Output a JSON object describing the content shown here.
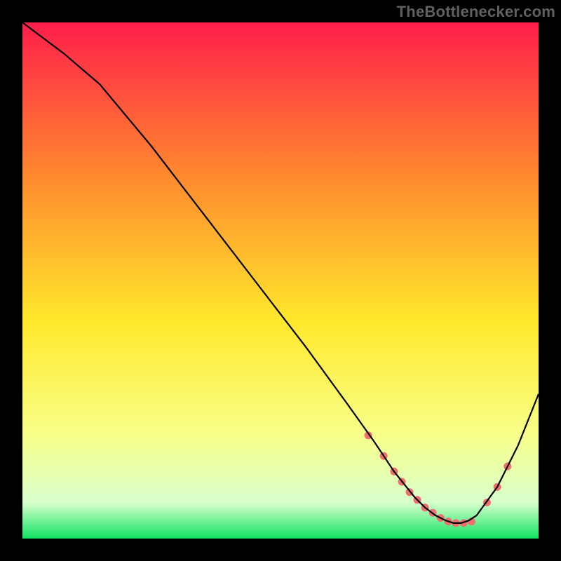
{
  "credit": "TheBottlenecker.com",
  "chart_data": {
    "type": "line",
    "title": "",
    "xlabel": "",
    "ylabel": "",
    "xlim": [
      0,
      100
    ],
    "ylim": [
      0,
      100
    ],
    "legend": false,
    "grid": false,
    "background_gradient": {
      "top": "#ff1e4b",
      "upper_mid": "#ff8a2e",
      "mid": "#ffe92c",
      "lower_mid": "#f8ff8a",
      "near_bottom": "#d8ffcc",
      "bottom": "#11e263"
    },
    "series": [
      {
        "name": "bottleneck-curve",
        "color": "#000000",
        "x": [
          0,
          8,
          15,
          25,
          35,
          45,
          55,
          63,
          68,
          70,
          72,
          74,
          76,
          78,
          80,
          82,
          83.5,
          85,
          86.5,
          88,
          92,
          96,
          100
        ],
        "y": [
          100,
          94,
          88,
          76,
          63,
          50,
          37,
          26,
          19,
          16,
          13,
          10.5,
          8,
          6,
          4.5,
          3.5,
          3,
          3,
          3.5,
          4.5,
          10,
          18,
          28
        ]
      }
    ],
    "markers": {
      "name": "highlight-dots",
      "color": "#f07070",
      "x": [
        67,
        70,
        72,
        73.5,
        75,
        76.5,
        78,
        79.5,
        81,
        82.5,
        84,
        85.5,
        87,
        90,
        92,
        94
      ],
      "y": [
        20,
        16,
        13,
        11,
        9,
        7.5,
        6,
        5,
        4,
        3.3,
        3,
        3,
        3.3,
        7,
        10,
        14
      ]
    }
  }
}
